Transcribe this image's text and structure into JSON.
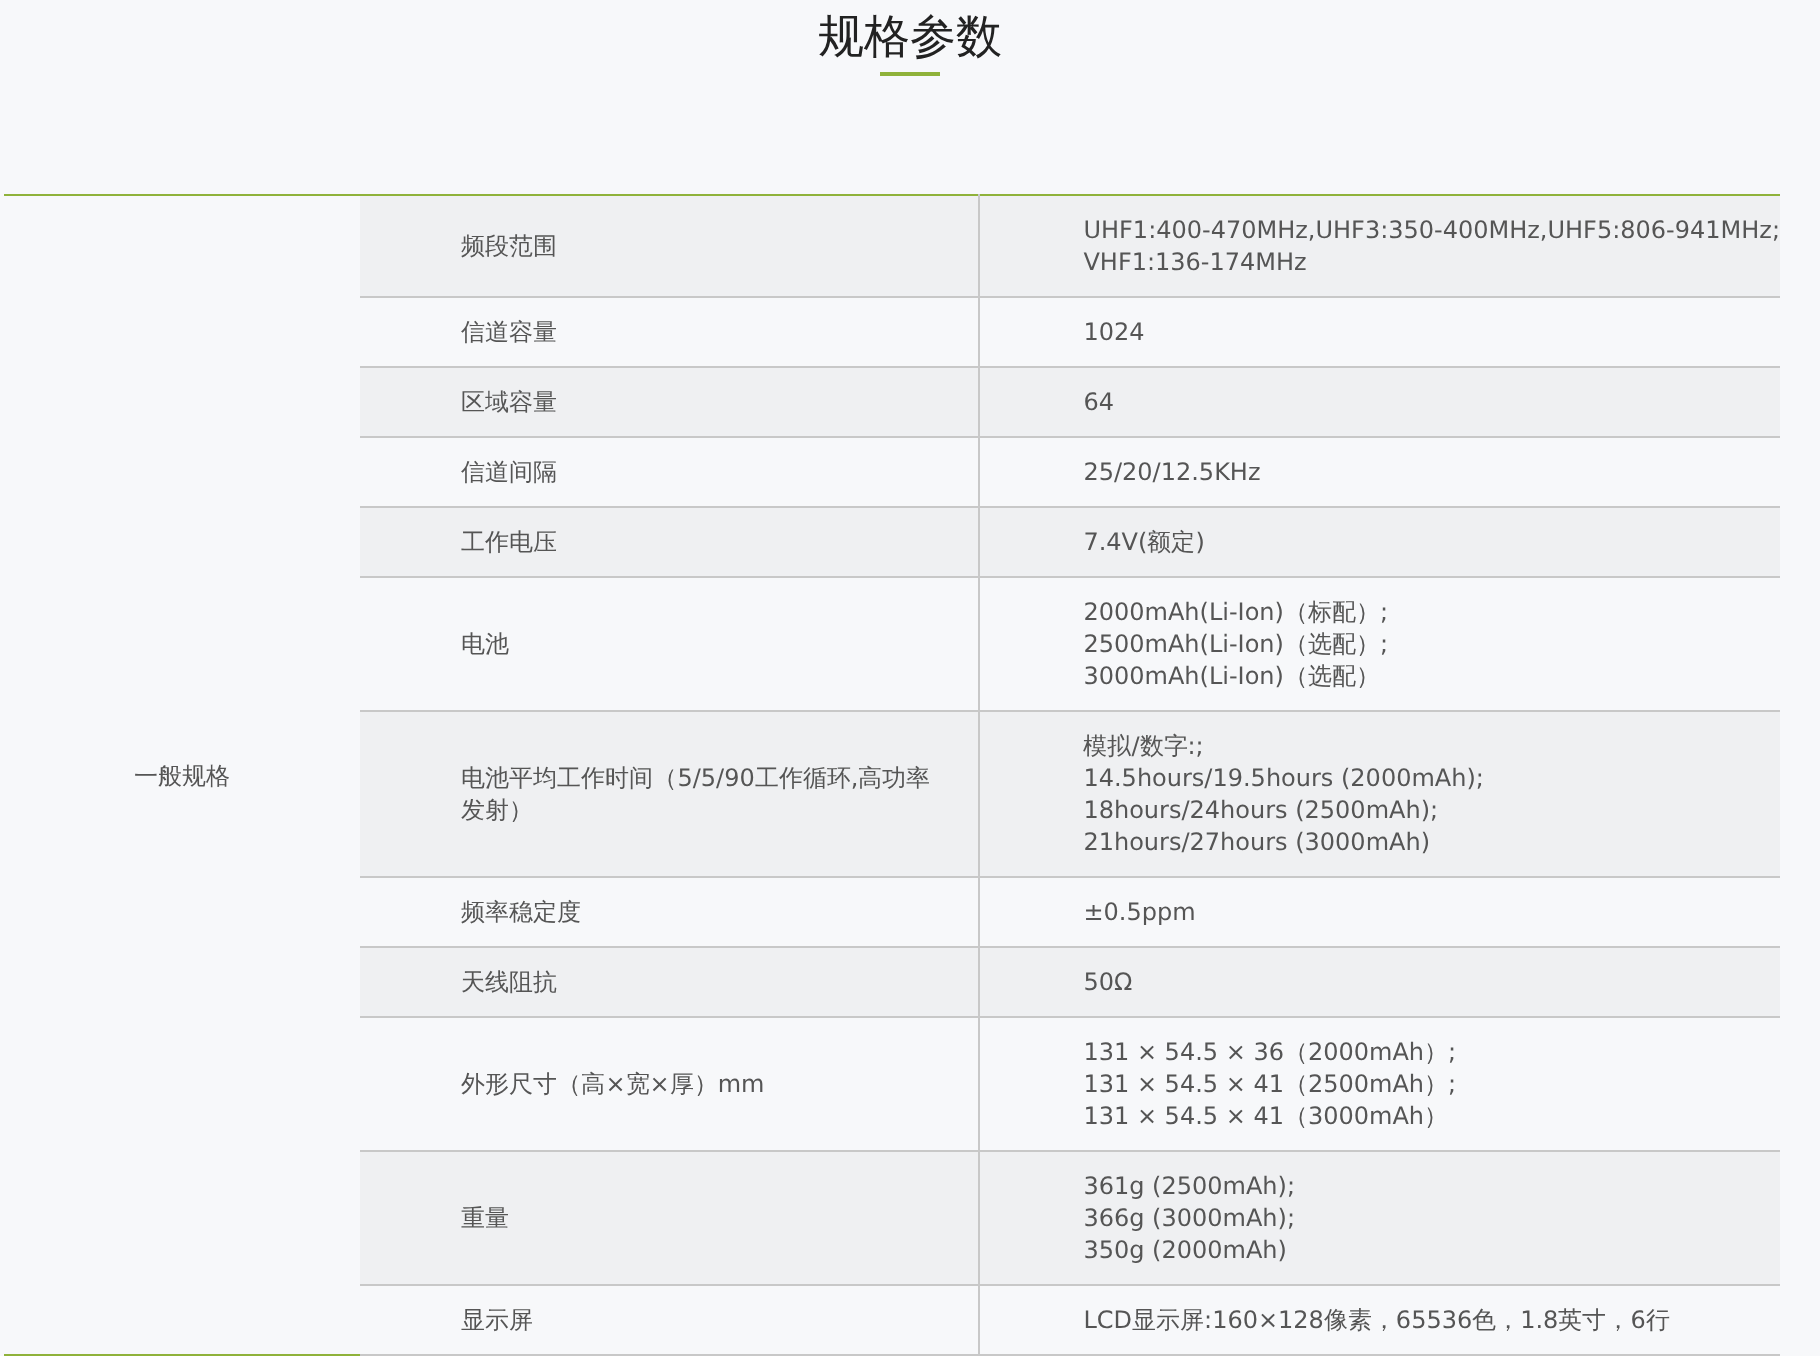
{
  "title": "规格参数",
  "group": "一般规格",
  "rows": [
    {
      "label": "频段范围",
      "value": [
        "UHF1:400-470MHz,UHF3:350-400MHz,UHF5:806-941MHz;",
        "VHF1:136-174MHz"
      ]
    },
    {
      "label": "信道容量",
      "value": [
        "1024"
      ]
    },
    {
      "label": "区域容量",
      "value": [
        "64"
      ]
    },
    {
      "label": "信道间隔",
      "value": [
        "25/20/12.5KHz"
      ]
    },
    {
      "label": "工作电压",
      "value": [
        "7.4V(额定)"
      ]
    },
    {
      "label": "电池",
      "value": [
        "2000mAh(Li-Ion)（标配）;",
        "2500mAh(Li-Ion)（选配）;",
        "3000mAh(Li-Ion)（选配）"
      ]
    },
    {
      "label": "电池平均工作时间（5/5/90工作循环,高功率发射）",
      "value": [
        "模拟/数字:;",
        "14.5hours/19.5hours (2000mAh);",
        "18hours/24hours (2500mAh);",
        "21hours/27hours (3000mAh)"
      ]
    },
    {
      "label": "频率稳定度",
      "value": [
        "±0.5ppm"
      ]
    },
    {
      "label": "天线阻抗",
      "value": [
        "50Ω"
      ]
    },
    {
      "label": "外形尺寸（高×宽×厚）mm",
      "value": [
        "131 × 54.5 × 36（2000mAh）;",
        "131 × 54.5 × 41（2500mAh）;",
        "131 × 54.5 × 41（3000mAh）"
      ]
    },
    {
      "label": "重量",
      "value": [
        "361g (2500mAh);",
        "366g (3000mAh);",
        "350g (2000mAh)"
      ]
    },
    {
      "label": "显示屏",
      "value": [
        "LCD显示屏:160×128像素，65536色，1.8英寸，6行"
      ]
    }
  ]
}
